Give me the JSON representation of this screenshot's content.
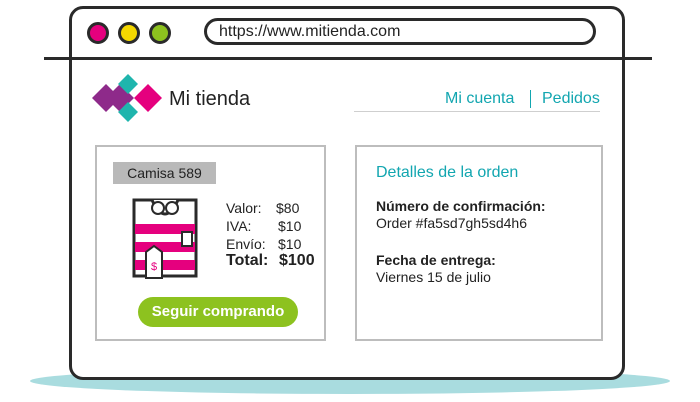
{
  "browser": {
    "url": "https://www.mitienda.com",
    "dot_colors": [
      "#e5007e",
      "#f5d800",
      "#8dc21f"
    ]
  },
  "header": {
    "brand": "Mi tienda",
    "nav": [
      "Mi cuenta",
      "Pedidos"
    ]
  },
  "product": {
    "name": "Camisa 589",
    "value_label": "Valor:",
    "value": "$80",
    "tax_label": "IVA:",
    "tax": "$10",
    "shipping_label": "Envío:",
    "shipping": "$10",
    "total_label": "Total:",
    "total": "$100",
    "continue_button": "Seguir comprando"
  },
  "details": {
    "title": "Detalles de la orden",
    "confirmation_label": "Número de confirmación:",
    "confirmation_value": "Order #fa5sd7gh5sd4h6",
    "delivery_label": "Fecha de entrega:",
    "delivery_value": "Viernes 15 de julio"
  },
  "colors": {
    "accent": "#12a6b0",
    "button": "#8dc21f",
    "brand_magenta": "#e5007e",
    "brand_purple": "#8e2a8a",
    "brand_teal": "#1fb5ad"
  },
  "icons": {
    "logo": "diamond-logo-icon",
    "shirt": "shirt-price-tag-icon"
  }
}
